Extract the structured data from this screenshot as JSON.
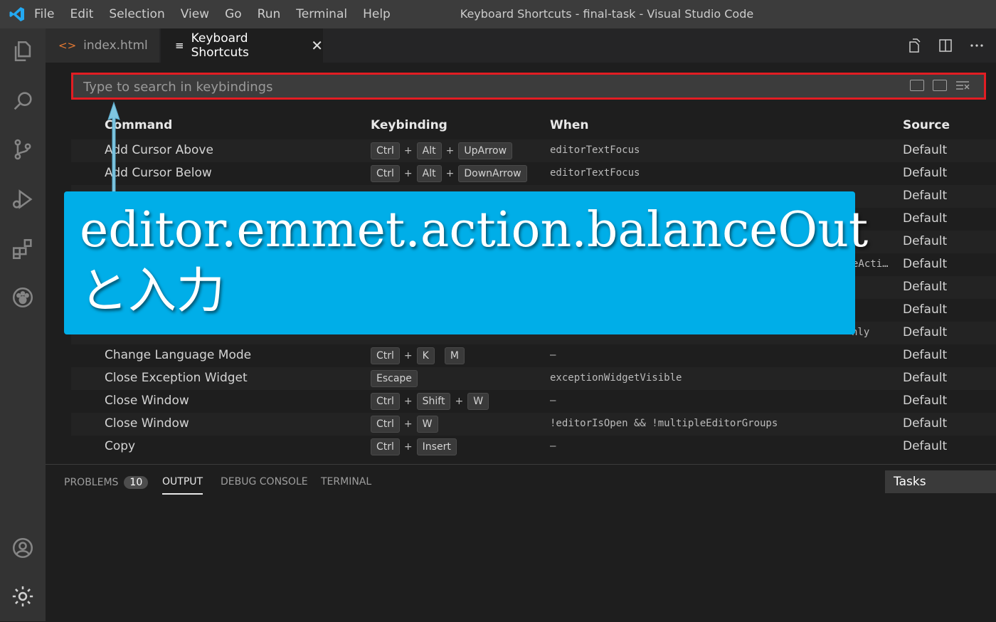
{
  "window": {
    "title": "Keyboard Shortcuts - final-task - Visual Studio Code"
  },
  "menu": [
    "File",
    "Edit",
    "Selection",
    "View",
    "Go",
    "Run",
    "Terminal",
    "Help"
  ],
  "tabs": [
    {
      "label": "index.html",
      "icon": "html-icon"
    },
    {
      "label": "Keyboard Shortcuts",
      "icon": "list-icon"
    }
  ],
  "search": {
    "placeholder": "Type to search in keybindings"
  },
  "columns": {
    "command": "Command",
    "keybinding": "Keybinding",
    "when": "When",
    "source": "Source"
  },
  "rows": [
    {
      "command": "Add Cursor Above",
      "keys": [
        [
          "Ctrl",
          "Alt",
          "UpArrow"
        ]
      ],
      "when": "editorTextFocus",
      "source": "Default"
    },
    {
      "command": "Add Cursor Below",
      "keys": [
        [
          "Ctrl",
          "Alt",
          "DownArrow"
        ]
      ],
      "when": "editorTextFocus",
      "source": "Default"
    },
    {
      "command": "",
      "keys": [],
      "when": "",
      "source": "Default"
    },
    {
      "command": "",
      "keys": [],
      "when": "",
      "source": "Default"
    },
    {
      "command": "",
      "keys": [],
      "when": "",
      "source": "Default"
    },
    {
      "command": "",
      "keys": [],
      "when": "eActi…",
      "source": "Default"
    },
    {
      "command": "",
      "keys": [],
      "when": "",
      "source": "Default"
    },
    {
      "command": "",
      "keys": [],
      "when": "",
      "source": "Default"
    },
    {
      "command": "",
      "keys": [],
      "when": "nly",
      "source": "Default"
    },
    {
      "command": "Change Language Mode",
      "keys": [
        [
          "Ctrl",
          "K"
        ],
        [
          "M"
        ]
      ],
      "when": "—",
      "source": "Default"
    },
    {
      "command": "Close Exception Widget",
      "keys": [
        [
          "Escape"
        ]
      ],
      "when": "exceptionWidgetVisible",
      "source": "Default"
    },
    {
      "command": "Close Window",
      "keys": [
        [
          "Ctrl",
          "Shift",
          "W"
        ]
      ],
      "when": "—",
      "source": "Default"
    },
    {
      "command": "Close Window",
      "keys": [
        [
          "Ctrl",
          "W"
        ]
      ],
      "when": "!editorIsOpen && !multipleEditorGroups",
      "source": "Default"
    },
    {
      "command": "Copy",
      "keys": [
        [
          "Ctrl",
          "Insert"
        ]
      ],
      "when": "—",
      "source": "Default"
    }
  ],
  "panel": {
    "tabs": [
      "PROBLEMS",
      "OUTPUT",
      "DEBUG CONSOLE",
      "TERMINAL"
    ],
    "problems_count": "10",
    "tasks_label": "Tasks"
  },
  "overlay": {
    "line1": "editor.emmet.action.balanceOut",
    "line2": "と入力"
  },
  "colors": {
    "accent": "#00aee8",
    "highlight_border": "#e21d23",
    "vscode_blue": "#23a9f2"
  }
}
